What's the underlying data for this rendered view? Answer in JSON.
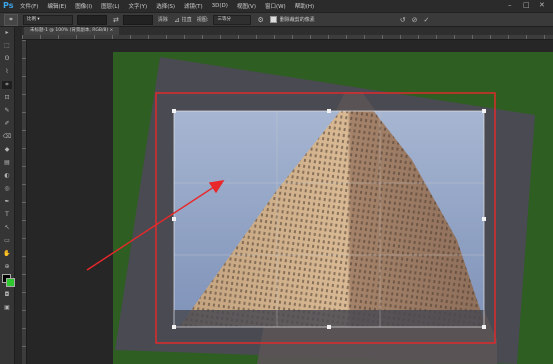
{
  "app": {
    "logo": "Ps"
  },
  "menu": [
    "文件(F)",
    "编辑(E)",
    "图像(I)",
    "图层(L)",
    "文字(Y)",
    "选择(S)",
    "滤镜(T)",
    "3D(D)",
    "视图(V)",
    "窗口(W)",
    "帮助(H)"
  ],
  "window_controls": {
    "minimize": "–",
    "maximize": "□",
    "close": "✕"
  },
  "options": {
    "tool_glyph": "⌗",
    "ratio_select": "比例 ▾",
    "swap_glyph": "⇄",
    "clear_label": "清除",
    "straighten_label": "拉直",
    "view_label": "视图:",
    "view_select": "三等分",
    "delete_pixels_label": "删除裁剪的像素",
    "reset_glyph": "↺",
    "cancel_glyph": "⊘",
    "commit_glyph": "✓"
  },
  "document": {
    "tab_label": "未标题-1 @ 100% (背景副本, RGB/8) ×"
  },
  "tools": [
    "▸",
    "⬚",
    "ʘ",
    "⌇",
    "⌗",
    "⊡",
    "✎",
    "✐",
    "⌫",
    "◆",
    "▤",
    "◐",
    "◎",
    "✒",
    "T",
    "↖",
    "▭",
    "✋",
    "⊕"
  ],
  "colors": {
    "canvas_bg": "#2e5e22",
    "overlay": "#4a4a52",
    "annotation_red": "#e8282a",
    "foreground": "#000000",
    "background": "#2ec82e"
  }
}
